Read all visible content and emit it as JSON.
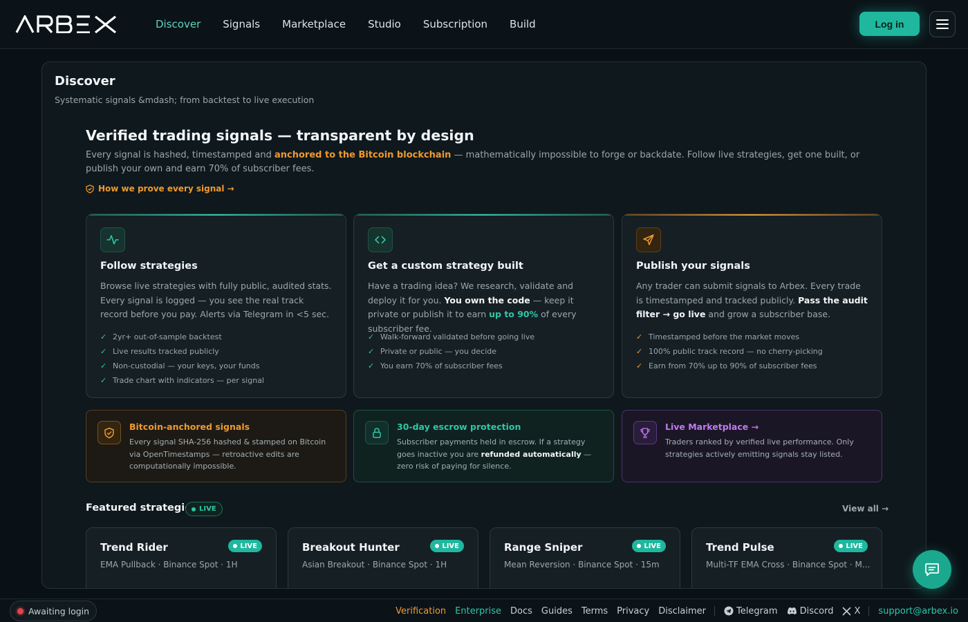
{
  "header": {
    "logo_text": "ARBEX",
    "nav": [
      {
        "label": "Discover",
        "active": true
      },
      {
        "label": "Signals"
      },
      {
        "label": "Marketplace"
      },
      {
        "label": "Studio"
      },
      {
        "label": "Subscription"
      },
      {
        "label": "Build"
      }
    ],
    "login_label": "Log in",
    "menu_icon": "hamburger-menu-icon"
  },
  "panel": {
    "title": "Discover",
    "subtitle": "Systematic signals &mdash; from backtest to live execution"
  },
  "hero": {
    "title": "Verified trading signals — transparent by design",
    "desc_before": "Every signal is hashed, timestamped and ",
    "desc_highlight": "anchored to the Bitcoin blockchain",
    "desc_after": " — mathematically impossible to forge or backdate. Follow live strategies, get one built, or publish your own and earn 70% of subscriber fees.",
    "prove_link": "How we prove every signal →"
  },
  "features": [
    {
      "icon": "activity-pulse-icon",
      "title": "Follow strategies",
      "desc": "Browse live strategies with fully public, audited stats. Every signal is logged — you see the real track record before you pay. Alerts via Telegram in <5 sec.",
      "items": [
        "2yr+ out-of-sample backtest",
        "Live results tracked publicly",
        "Non-custodial — your keys, your funds",
        "Trade chart with indicators — per signal"
      ]
    },
    {
      "icon": "code-brackets-icon",
      "title": "Get a custom strategy built",
      "desc_1": "Have a trading idea? We research, validate and deploy it for you. ",
      "desc_bold": "You own the code",
      "desc_2": " — keep it private or publish it to earn ",
      "desc_green": "up to 90%",
      "desc_3": " of every subscriber fee.",
      "items": [
        "Walk-forward validated before going live",
        "Private or public — you decide",
        "You earn 70% of subscriber fees"
      ]
    },
    {
      "icon": "send-paper-plane-icon",
      "title": "Publish your signals",
      "desc_1": "Any trader can submit signals to Arbex. Every trade is timestamped and tracked publicly. ",
      "desc_bold": "Pass the audit filter → go live",
      "desc_2": " and grow a subscriber base.",
      "items": [
        "Timestamped before the market moves",
        "100% public track record — no cherry-picking",
        "Earn from 70% up to 90% of subscriber fees"
      ]
    }
  ],
  "info_cards": [
    {
      "icon": "shield-check-icon",
      "title": "Bitcoin-anchored signals",
      "desc": "Every signal SHA-256 hashed & stamped on Bitcoin via OpenTimestamps — retroactive edits are computationally impossible."
    },
    {
      "icon": "lock-icon",
      "title": "30-day escrow protection",
      "desc_1": "Subscriber payments held in escrow. If a strategy goes inactive you are ",
      "desc_bold": "refunded automatically",
      "desc_2": " — zero risk of paying for silence."
    },
    {
      "icon": "trophy-icon",
      "title": "Live Marketplace →",
      "desc": "Traders ranked by verified live performance. Only strategies actively emitting signals stay listed."
    }
  ],
  "featured": {
    "title": "Featured strategies",
    "live_label": "LIVE",
    "view_all": "View all →",
    "strategies": [
      {
        "name": "Trend Rider",
        "badge": "LIVE",
        "meta": "EMA Pullback · Binance Spot · 1H"
      },
      {
        "name": "Breakout Hunter",
        "badge": "LIVE",
        "meta": "Asian Breakout · Binance Spot · 1H"
      },
      {
        "name": "Range Sniper",
        "badge": "LIVE",
        "meta": "Mean Reversion · Binance Spot · 15m"
      },
      {
        "name": "Trend Pulse",
        "badge": "LIVE",
        "meta": "Multi-TF EMA Cross · Binance Spot · M..."
      }
    ]
  },
  "chat_icon": "chat-bubble-icon",
  "footer": {
    "status": "Awaiting login",
    "links": [
      {
        "label": "Verification",
        "color": "#ef9a2f"
      },
      {
        "label": "Enterprise",
        "color": "#2fc6a8"
      },
      {
        "label": "Docs"
      },
      {
        "label": "Guides"
      },
      {
        "label": "Terms"
      },
      {
        "label": "Privacy"
      },
      {
        "label": "Disclaimer"
      }
    ],
    "social": [
      {
        "label": "Telegram",
        "icon": "telegram-icon"
      },
      {
        "label": "Discord",
        "icon": "discord-icon"
      },
      {
        "label": "X",
        "icon": "x-icon"
      }
    ],
    "email": "support@arbex.io"
  },
  "colors": {
    "accent_teal": "#2fc6a8",
    "accent_orange": "#ef9a2f",
    "accent_purple": "#b061e8",
    "background": "#0a1116"
  }
}
